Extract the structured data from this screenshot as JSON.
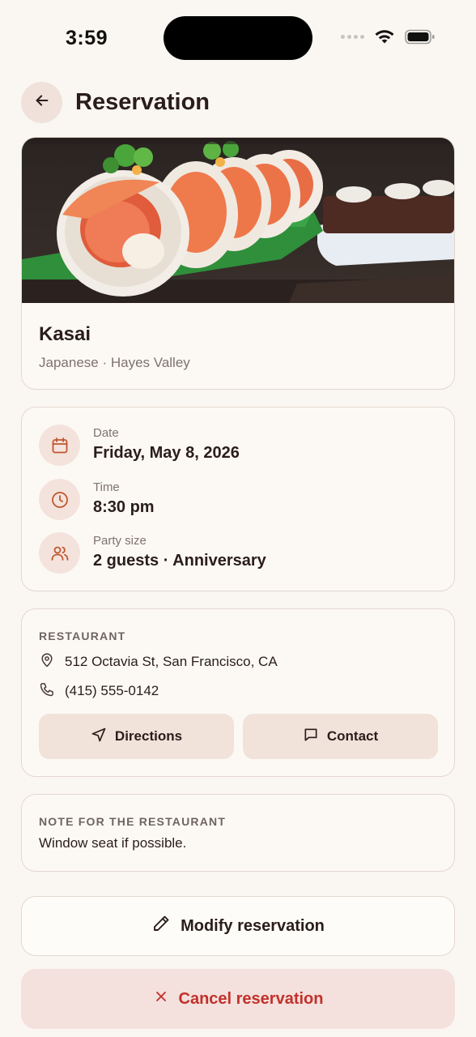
{
  "status_bar": {
    "time": "3:59"
  },
  "header": {
    "title": "Reservation",
    "back_icon": "arrow-left-icon"
  },
  "restaurant": {
    "name": "Kasai",
    "meta": "Japanese · Hayes Valley",
    "photo": "sushi-rolls-photo"
  },
  "details": {
    "date": {
      "label": "Date",
      "value": "Friday, May 8, 2026",
      "icon": "calendar-icon"
    },
    "time": {
      "label": "Time",
      "value": "8:30 pm",
      "icon": "clock-icon"
    },
    "party": {
      "label": "Party size",
      "value": "2 guests · Anniversary",
      "icon": "users-icon"
    }
  },
  "restaurant_info": {
    "section_label": "RESTAURANT",
    "address": "512 Octavia St, San Francisco, CA",
    "phone": "(415) 555-0142",
    "directions_label": "Directions",
    "contact_label": "Contact"
  },
  "note": {
    "section_label": "NOTE FOR THE RESTAURANT",
    "text": "Window seat if possible."
  },
  "actions": {
    "modify_label": "Modify reservation",
    "cancel_label": "Cancel reservation"
  },
  "colors": {
    "background": "#faf6f1",
    "accent": "#c0562f",
    "danger": "#c2312c",
    "danger_bg": "#f4e0dc"
  }
}
